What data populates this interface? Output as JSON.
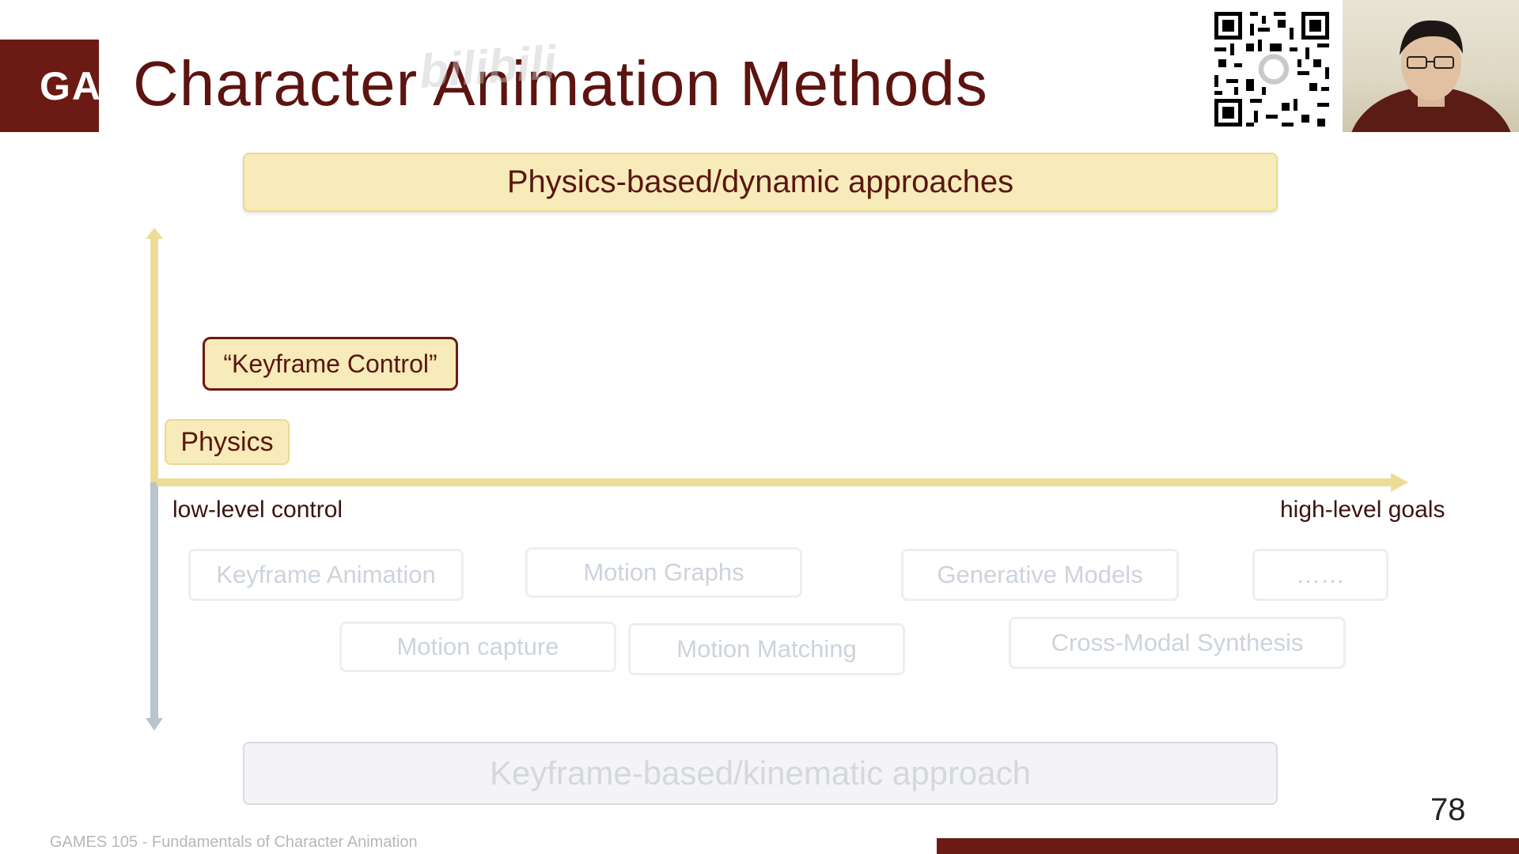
{
  "slide": {
    "logo_text": "GA",
    "title": "Character Animation Methods",
    "watermark": "bilibili",
    "page_number": "78",
    "footer": "GAMES 105 - Fundamentals of Character Animation"
  },
  "diagram": {
    "top_header": "Physics-based/dynamic approaches",
    "bottom_header": "Keyframe-based/kinematic approach",
    "axis": {
      "left_label": "low-level control",
      "right_label": "high-level goals"
    },
    "highlighted": {
      "keyframe_control": "“Keyframe Control”",
      "physics": "Physics"
    },
    "methods": {
      "keyframe_animation": "Keyframe Animation",
      "motion_graphs": "Motion Graphs",
      "generative_models": "Generative Models",
      "more": "……",
      "motion_capture": "Motion capture",
      "motion_matching": "Motion Matching",
      "cross_modal_synthesis": "Cross-Modal Synthesis"
    }
  },
  "colors": {
    "brand": "#6b1a14",
    "highlight_fill": "#f6ebb9",
    "axis_gold": "#eddc97",
    "axis_grey": "#b9c4cc",
    "faded_text": "#cdd3dc"
  },
  "icons": {
    "qr": "qr-code-icon",
    "webcam": "presenter-webcam"
  }
}
